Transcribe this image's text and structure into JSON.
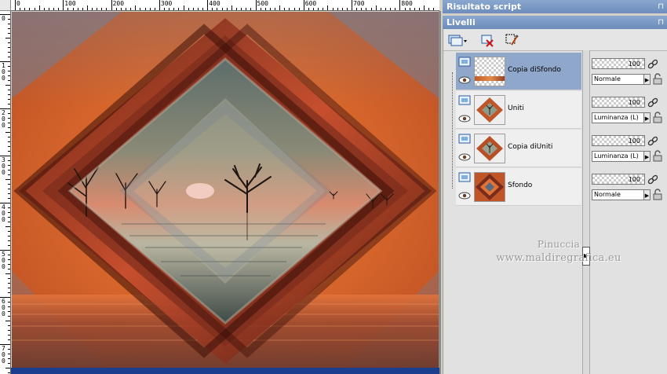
{
  "rulers": {
    "horizontal_labels": [
      "0",
      "100",
      "200",
      "300",
      "400",
      "500",
      "600",
      "700",
      "800"
    ],
    "vertical_labels": [
      "0",
      "1\n0\n0",
      "2\n0\n0",
      "3\n0\n0",
      "4\n0\n0",
      "5\n0\n0",
      "6\n0\n0",
      "7\n0\n0"
    ]
  },
  "panels": {
    "script_output_title": "Risultato script",
    "layers_title": "Livelli",
    "pin_glyph": "⊓"
  },
  "toolbar": {
    "icons": [
      "new-layer-dropdown-icon",
      "delete-layer-icon",
      "edit-selection-icon"
    ]
  },
  "layers": [
    {
      "name": "Copia diSfondo",
      "opacity": "100",
      "blend_mode": "Normale",
      "selected": true
    },
    {
      "name": "Uniti",
      "opacity": "100",
      "blend_mode": "Luminanza (L)",
      "selected": false
    },
    {
      "name": "Copia diUniti",
      "opacity": "100",
      "blend_mode": "Luminanza (L)",
      "selected": false
    },
    {
      "name": "Sfondo",
      "opacity": "100",
      "blend_mode": "Normale",
      "selected": false
    }
  ],
  "watermark": {
    "line1": "Pinuccia",
    "line2": "www.maldiregrafica.eu"
  },
  "colors": {
    "panel_title": "#7393c2",
    "selected_row": "#8fa7cb",
    "canvas_orange": "#d9692e"
  }
}
